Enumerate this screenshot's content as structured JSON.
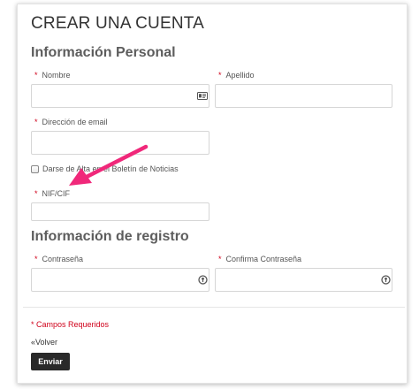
{
  "form": {
    "title": "CREAR UNA CUENTA",
    "required_marker": "*",
    "personal": {
      "heading": "Información Personal",
      "first_name_label": "Nombre",
      "first_name_value": "",
      "last_name_label": "Apellido",
      "last_name_value": "",
      "email_label": "Dirección de email",
      "email_value": "",
      "newsletter_label": "Darse de Alta en el Boletín de Noticias",
      "newsletter_checked": false,
      "tax_id_label": "NIF/CIF",
      "tax_id_value": ""
    },
    "registration": {
      "heading": "Información de registro",
      "password_label": "Contraseña",
      "password_value": "",
      "confirm_password_label": "Confirma Contraseña",
      "confirm_password_value": ""
    },
    "required_note": "* Campos Requeridos",
    "back_link": "«Volver",
    "submit_label": "Enviar"
  },
  "icons": {
    "first_name_field": "contact-card-icon",
    "password_field": "password-key-icon",
    "confirm_password_field": "password-key-icon",
    "annotation": "pink-arrow-icon"
  },
  "colors": {
    "required": "#d0021b",
    "annotation_arrow": "#f0287a",
    "submit_background": "#2a2a2a",
    "heading": "#5d5d5d"
  }
}
